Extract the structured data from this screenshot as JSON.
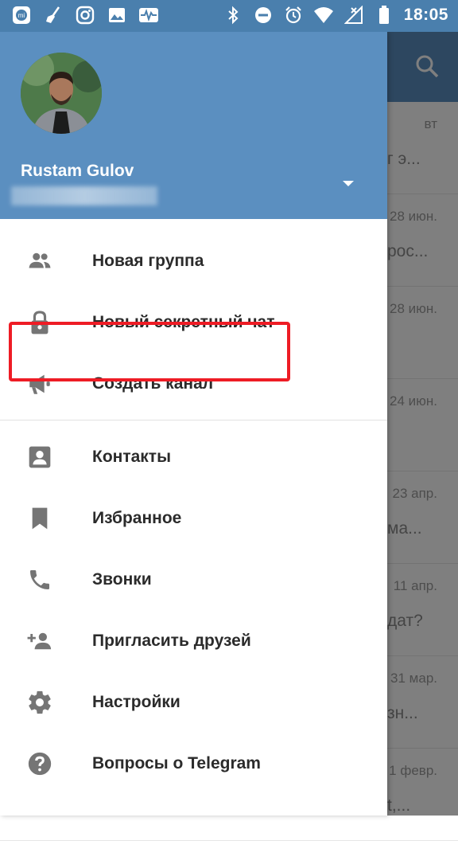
{
  "status_bar": {
    "time": "18:05",
    "left_icons": [
      "mi-icon",
      "broom-icon",
      "instagram-icon",
      "gallery-icon",
      "activity-icon"
    ],
    "right_icons": [
      "bluetooth-icon",
      "do-not-disturb-icon",
      "alarm-icon",
      "wifi-icon",
      "no-signal-icon",
      "battery-icon"
    ]
  },
  "drawer": {
    "user_name": "Rustam Gulov",
    "menu_group_1": [
      {
        "label": "Новая группа",
        "icon": "group-icon"
      },
      {
        "label": "Новый секретный чат",
        "icon": "lock-icon"
      },
      {
        "label": "Создать канал",
        "icon": "megaphone-icon"
      }
    ],
    "menu_group_2": [
      {
        "label": "Контакты",
        "icon": "contact-card-icon"
      },
      {
        "label": "Избранное",
        "icon": "bookmark-icon"
      },
      {
        "label": "Звонки",
        "icon": "phone-icon"
      },
      {
        "label": "Пригласить друзей",
        "icon": "add-person-icon"
      },
      {
        "label": "Настройки",
        "icon": "gear-icon"
      },
      {
        "label": "Вопросы о Telegram",
        "icon": "help-icon"
      }
    ]
  },
  "background_chats": {
    "rows": [
      {
        "date": "вт",
        "preview": "г э..."
      },
      {
        "date": "28 июн.",
        "preview": "рос..."
      },
      {
        "date": "28 июн.",
        "preview": ""
      },
      {
        "date": "24 июн.",
        "preview": ""
      },
      {
        "date": "23 апр.",
        "preview": "ма..."
      },
      {
        "date": "11 апр.",
        "preview": "дат?"
      },
      {
        "date": "31 мар.",
        "preview": "зн..."
      },
      {
        "date": "1 февр.",
        "preview": "t,..."
      }
    ]
  },
  "colors": {
    "status_bar": "#4a7fad",
    "header": "#5b8fc0",
    "highlight": "#ee1c25",
    "icon": "#757575"
  }
}
